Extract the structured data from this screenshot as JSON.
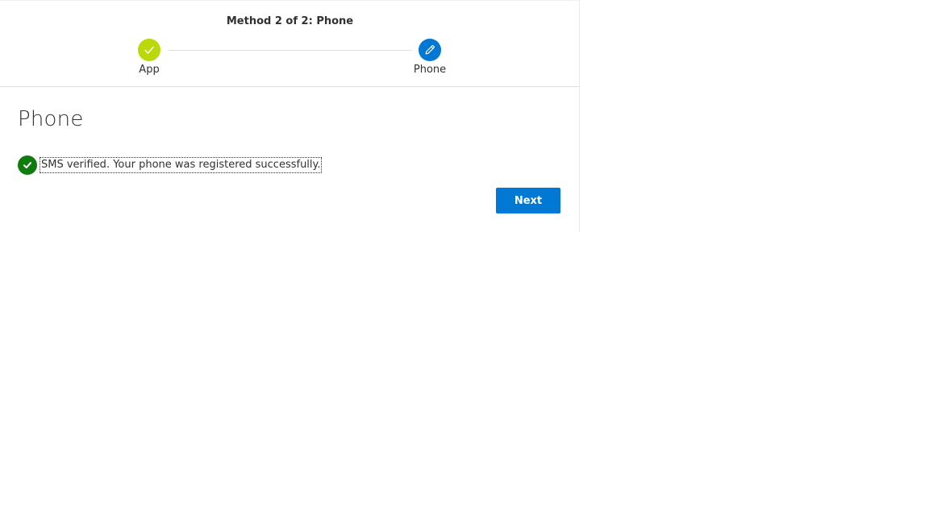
{
  "header": {
    "method_title": "Method 2 of 2: Phone",
    "steps": [
      {
        "label": "App",
        "state": "complete",
        "icon": "checkmark-icon",
        "color": "#bad80a"
      },
      {
        "label": "Phone",
        "state": "current",
        "icon": "pencil-icon",
        "color": "#0078d4"
      }
    ]
  },
  "main": {
    "title": "Phone",
    "status": {
      "icon": "checkmark-circle-icon",
      "color": "#107c10",
      "text": "SMS verified. Your phone was registered successfully."
    },
    "next_button": {
      "label": "Next",
      "color": "#0078d4"
    }
  }
}
